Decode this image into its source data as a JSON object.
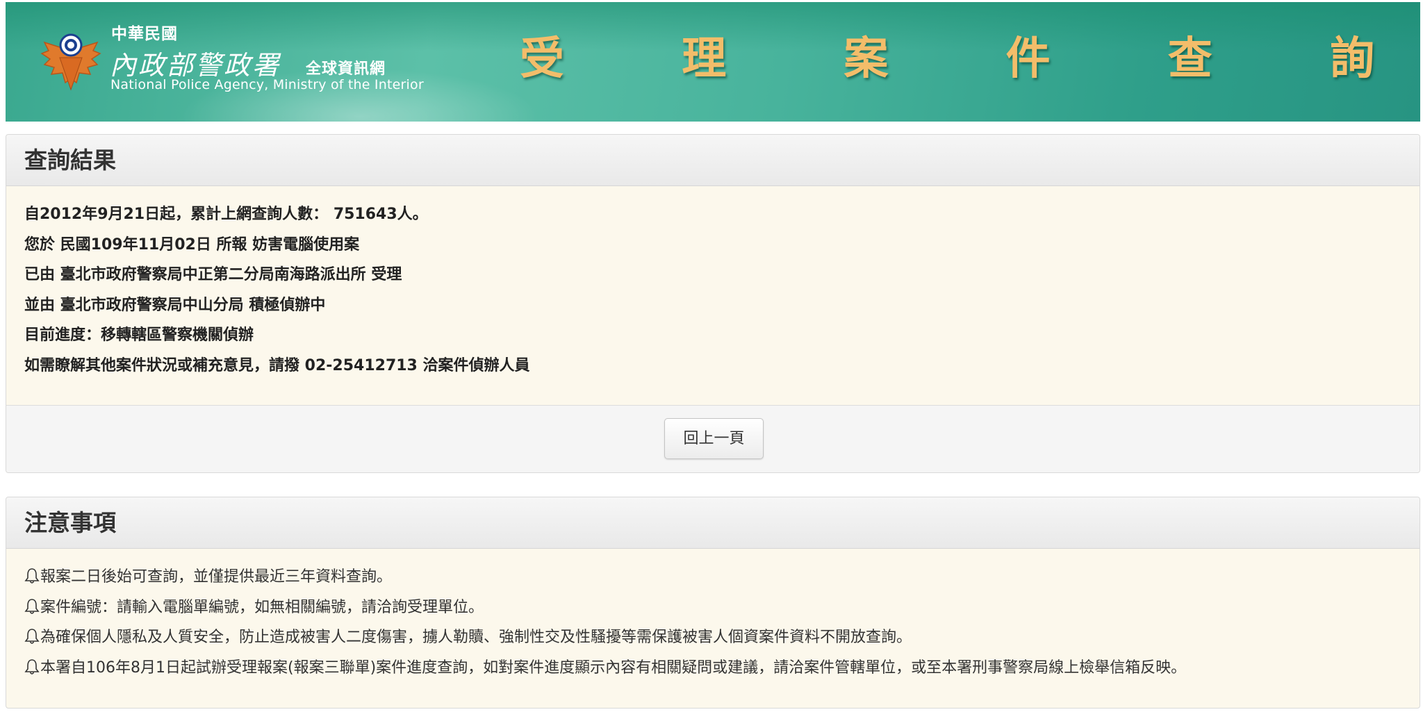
{
  "banner": {
    "roc": "中華民國",
    "ministry": "內政部警政署",
    "portal": "全球資訊網",
    "english": "National Police Agency, Ministry of the Interior",
    "title_chars": [
      "受",
      "理",
      "案",
      "件",
      "查",
      "詢"
    ],
    "title_color": "#f3bd6a"
  },
  "result": {
    "heading": "查詢結果",
    "lines": [
      "自2012年9月21日起，累計上網查詢人數： 751643人。",
      "您於 民國109年11月02日 所報 妨害電腦使用案",
      "已由 臺北市政府警察局中正第二分局南海路派出所 受理",
      "並由 臺北市政府警察局中山分局 積極偵辦中",
      "目前進度：移轉轄區警察機關偵辦",
      "如需瞭解其他案件狀況或補充意見，請撥 02-25412713 洽案件偵辦人員"
    ],
    "back_button": "回上一頁"
  },
  "notes": {
    "heading": "注意事項",
    "icon": "bell-icon",
    "items": [
      "報案二日後始可查詢，並僅提供最近三年資料查詢。",
      "案件編號：請輸入電腦單編號，如無相關編號，請洽詢受理單位。",
      "為確保個人隱私及人質安全，防止造成被害人二度傷害，擄人勒贖、強制性交及性騷擾等需保護被害人個資案件資料不開放查詢。",
      "本署自106年8月1日起試辦受理報案(報案三聯單)案件進度查詢，如對案件進度顯示內容有相關疑問或建議，請洽案件管轄單位，或至本署刑事警察局線上檢舉信箱反映。"
    ]
  },
  "colors": {
    "banner_green": "#3aa88f",
    "panel_body": "#fcf8ec",
    "panel_heading": "#eeeeee"
  }
}
